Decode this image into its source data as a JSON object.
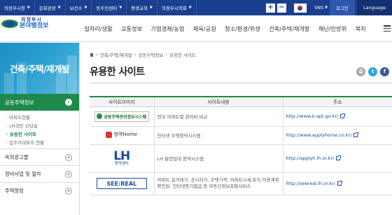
{
  "topbar": {
    "links": [
      "의정부시청",
      "문화관광",
      "보건소",
      "동주민센터",
      "평생교육",
      "의정부시의회"
    ],
    "zoom_in": "+",
    "zoom_out": "−",
    "sns": "SNS",
    "login": "로그인",
    "language": "Language"
  },
  "logo": {
    "top": "의정부시",
    "bottom": "분야별정보"
  },
  "gnb": [
    "일자리/생활",
    "교통정보",
    "기업경제/농업",
    "체육/공원",
    "청소/환경/위생",
    "건축/주택/재개발",
    "재난/민방위",
    "복지"
  ],
  "sidebar": {
    "title": "건축/주택/재개발",
    "active_menu": "공동주택정보",
    "sub_items": [
      "아파트현황",
      "LH국민 상담실",
      "유용한 사이트",
      "입주자대표의 현황"
    ],
    "menus": [
      "옥외광고물",
      "정비사업 및 절차",
      "주택행정"
    ]
  },
  "breadcrumb": [
    "건축/주택/재개발",
    "공동주택정보",
    "유용한 사이트"
  ],
  "page_title": "유용한 사이트",
  "table": {
    "headers": [
      "사이트이미지",
      "사이트내용",
      "주소"
    ],
    "rows": [
      {
        "logo_text": "공동주택관리정보시스템",
        "desc": "전국 아파트별 관리비 비교",
        "url": "http://www.k-apt.go.kr/"
      },
      {
        "logo_text": "청약Home",
        "desc": "인터넷 주택청약시스템",
        "url": "http://www.applyhome.co.kr/"
      },
      {
        "logo_text": "LH",
        "logo_sub": "청약센터",
        "desc": "LH 분양임대 청약시스템",
        "url": "http://applyh.lh.or.kr/"
      },
      {
        "logo_text": "SEE:REAL",
        "desc": "아파트 실거래가, 공시지가, 주택가격, 아파트시세,토지 이용계획확인원, 인터넷등기발급 등 부동산정보포털서비스",
        "url": "http://seereal.lh.or.kr/"
      }
    ]
  },
  "colors": {
    "top_bar": "#1b3f8f",
    "accent_green": "#1e8a4a",
    "link_blue": "#1a4aa0"
  }
}
